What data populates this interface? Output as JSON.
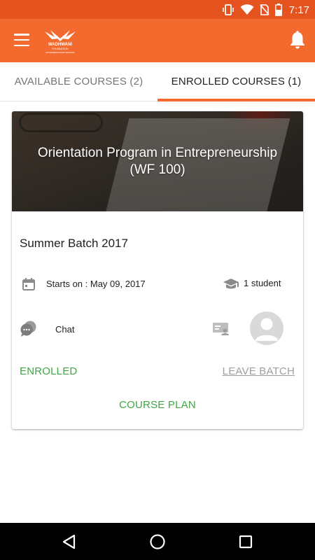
{
  "status_bar": {
    "time": "7:17",
    "icons": [
      "vibrate-icon",
      "wifi-icon",
      "no-sim-icon",
      "battery-icon"
    ]
  },
  "app_bar": {
    "logo_text": "WADHWANI",
    "logo_subtext": "FOUNDATION",
    "logo_tagline": "ENTREPRENEURSHIP NETWORK",
    "icons": [
      "menu-icon",
      "notifications-bell-icon"
    ]
  },
  "tabs": [
    {
      "label": "AVAILABLE COURSES (2)",
      "active": false
    },
    {
      "label": "ENROLLED COURSES (1)",
      "active": true
    }
  ],
  "course_card": {
    "title_line1": "Orientation Program in Entrepreneurship",
    "title_line2": "(WF 100)",
    "batch_name": "Summer Batch 2017",
    "start_text": "Starts on : May 09, 2017",
    "students_text": "1 student",
    "chat_label": "Chat",
    "status_label": "ENROLLED",
    "leave_label": "LEAVE BATCH",
    "course_plan_label": "COURSE PLAN"
  },
  "nav_bar": {
    "icons": [
      "back-icon",
      "home-icon",
      "recents-icon"
    ]
  },
  "colors": {
    "status_bar": "#e5531f",
    "app_bar": "#f26a2e",
    "tab_indicator": "#f26a2e",
    "accent_green": "#3ea843",
    "muted_grey": "#9e9e9e"
  }
}
